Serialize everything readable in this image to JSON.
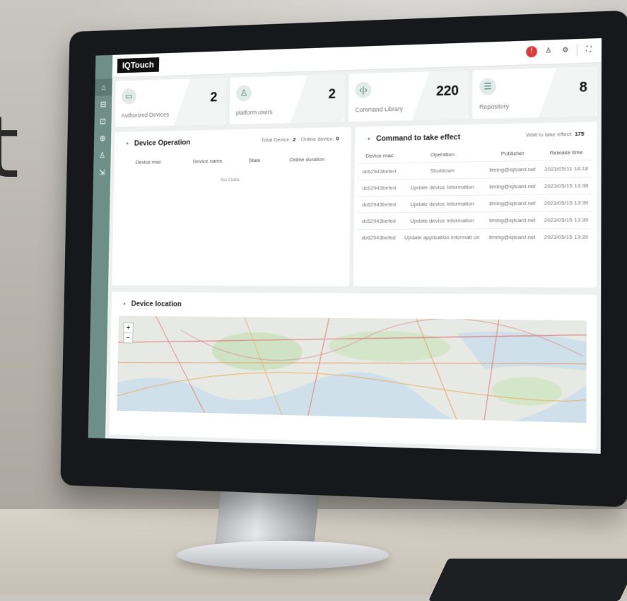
{
  "backdrop": {
    "letter": "t"
  },
  "app": {
    "logo": "IQTouch"
  },
  "sidebar": {
    "items": [
      {
        "icon": "home-icon",
        "glyph": "⌂"
      },
      {
        "icon": "monitor-icon",
        "glyph": "⊟"
      },
      {
        "icon": "terminal-icon",
        "glyph": "⊡"
      },
      {
        "icon": "cube-icon",
        "glyph": "⊛"
      },
      {
        "icon": "users-icon",
        "glyph": "♙"
      },
      {
        "icon": "export-icon",
        "glyph": "⇲"
      }
    ]
  },
  "topbar": {
    "icons": [
      {
        "icon": "alert-icon",
        "glyph": "!"
      },
      {
        "icon": "user-icon",
        "glyph": "♙"
      },
      {
        "icon": "settings-icon",
        "glyph": "⚙"
      },
      {
        "icon": "fullscreen-icon",
        "glyph": "⛶"
      }
    ]
  },
  "cards": [
    {
      "label": "Authorized Devices",
      "value": "2",
      "icon": "monitor-icon",
      "glyph": "▭"
    },
    {
      "label": "platform users",
      "value": "2",
      "icon": "user-icon",
      "glyph": "♙"
    },
    {
      "label": "Command Library",
      "value": "220",
      "icon": "code-icon",
      "glyph": "‹|›"
    },
    {
      "label": "Repository",
      "value": "8",
      "icon": "list-icon",
      "glyph": "☰"
    }
  ],
  "device_operation": {
    "title": "Device Operation",
    "total_label": "Total Device:",
    "total_value": "2",
    "online_label": "Online device:",
    "online_value": "0",
    "columns": [
      "Device mac",
      "Device name",
      "State",
      "Online duration"
    ],
    "empty_text": "No Data"
  },
  "commands": {
    "title": "Command to take effect",
    "wait_label": "Wait to take effect:",
    "wait_value": "175",
    "columns": [
      "Device mac",
      "Operation",
      "Publisher",
      "Release time"
    ],
    "rows": [
      [
        "dc62943befed",
        "Shutdown",
        "liming@iqtcard.net",
        "2023/05/11 14:18"
      ],
      [
        "dc62943befed",
        "Update device Information",
        "liming@iqtcard.net",
        "2023/05/15 13:38"
      ],
      [
        "dc62943befed",
        "Update device Information",
        "liming@iqtcard.net",
        "2023/05/15 13:39"
      ],
      [
        "dc62943befed",
        "Update device Information",
        "liming@iqtcard.net",
        "2023/05/15 13:39"
      ],
      [
        "dc62943befed",
        "Update application informati on",
        "liming@iqtcard.net",
        "2023/05/15 13:39"
      ]
    ]
  },
  "map": {
    "title": "Device location",
    "zoom_in": "+",
    "zoom_out": "−"
  }
}
